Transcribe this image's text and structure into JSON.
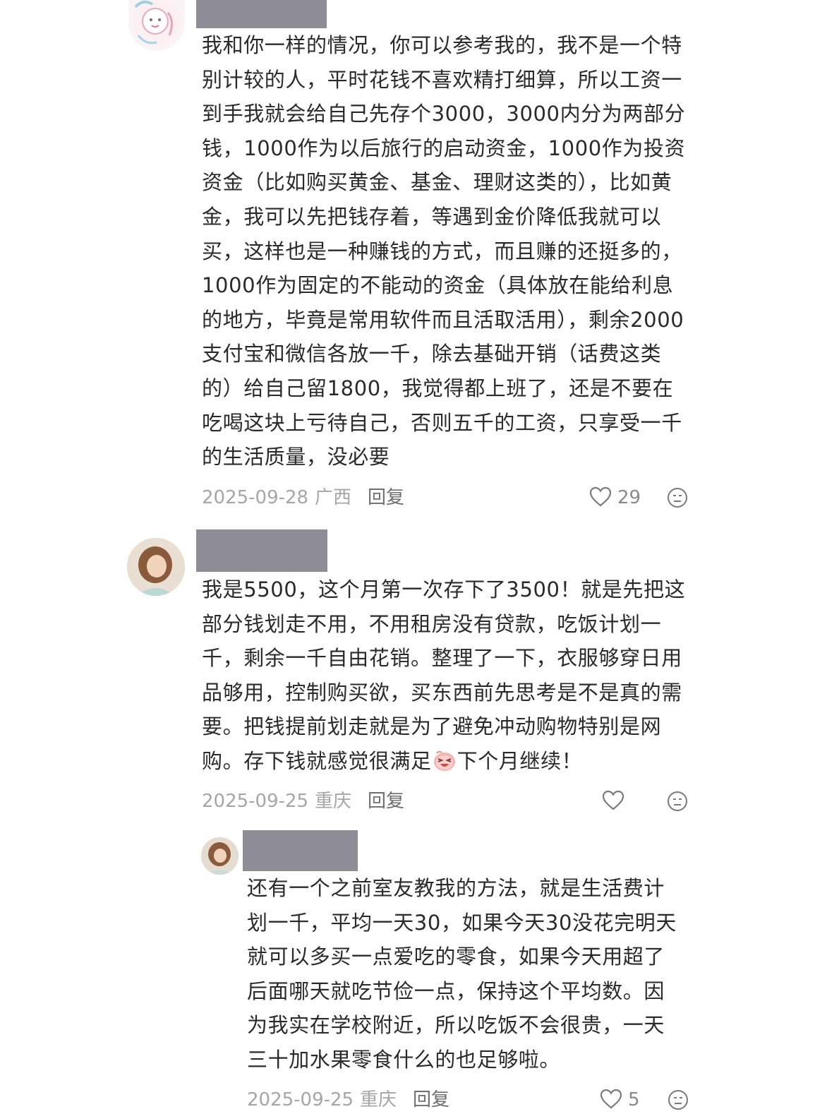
{
  "comments": [
    {
      "text": "我和你一样的情况，你可以参考我的，我不是一个特别计较的人，平时花钱不喜欢精打细算，所以工资一到手我就会给自己先存个3000，3000内分为两部分钱，1000作为以后旅行的启动资金，1000作为投资资金（比如购买黄金、基金、理财这类的），比如黄金，我可以先把钱存着，等遇到金价降低我就可以买，这样也是一种赚钱的方式，而且赚的还挺多的，1000作为固定的不能动的资金（具体放在能给利息的地方，毕竟是常用软件而且活取活用），剩余2000支付宝和微信各放一千，除去基础开销（话费这类的）给自己留1800，我觉得都上班了，还是不要在吃喝这块上亏待自己，否则五千的工资，只享受一千的生活质量，没必要",
      "date": "2025-09-28",
      "location": "广西",
      "reply_label": "回复",
      "like_count": "29"
    },
    {
      "text_before_emoji": "我是5500，这个月第一次存下了3500！就是先把这部分钱划走不用，不用租房没有贷款，吃饭计划一千，剩余一千自由花销。整理了一下，衣服够穿日用品够用，控制购买欲，买东西前先思考是不是真的需要。把钱提前划走就是为了避免冲动购物特别是网购。存下钱就感觉很满足",
      "text_after_emoji": "下个月继续！",
      "emoji_icon": "laughing-face-emoji",
      "date": "2025-09-25",
      "location": "重庆",
      "reply_label": "回复",
      "like_count": ""
    },
    {
      "text": "还有一个之前室友教我的方法，就是生活费计划一千，平均一天30，如果今天30没花完明天就可以多买一点爱吃的零食，如果今天用超了后面哪天就吃节俭一点，保持这个平均数。因为我实在学校附近，所以吃饭不会很贵，一天三十加水果零食什么的也足够啦。",
      "date": "2025-09-25",
      "location": "重庆",
      "reply_label": "回复",
      "like_count": "5"
    }
  ],
  "colors": {
    "redaction": "#8e8c95",
    "meta_text": "#a6a6a6",
    "icon_stroke": "#7a7a7a"
  },
  "icons": [
    "heart-icon",
    "neutral-face-icon",
    "laughing-face-emoji"
  ]
}
